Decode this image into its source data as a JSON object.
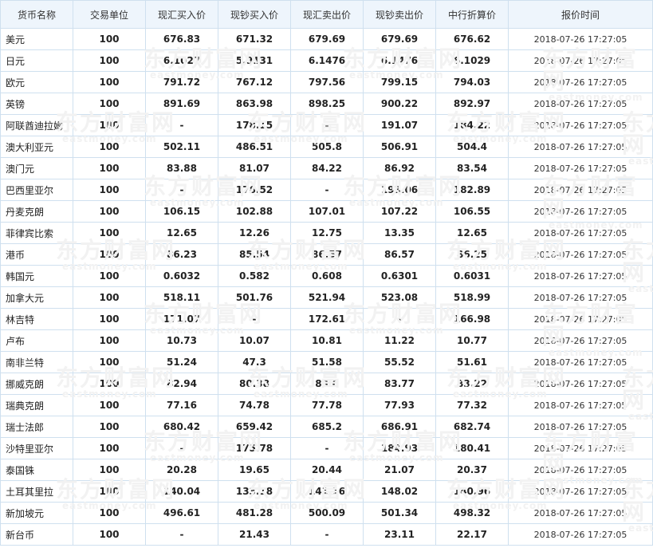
{
  "headers": [
    "货币名称",
    "交易单位",
    "现汇买入价",
    "现钞买入价",
    "现汇卖出价",
    "现钞卖出价",
    "中行折算价",
    "报价时间"
  ],
  "watermark": {
    "cn": "东方财富网",
    "en": "eastmoney.com"
  },
  "rows": [
    {
      "name": "美元",
      "unit": "100",
      "fx_buy": "676.83",
      "cash_buy": "671.32",
      "fx_sell": "679.69",
      "cash_sell": "679.69",
      "mid": "676.62",
      "time": "2018-07-26 17:27:05"
    },
    {
      "name": "日元",
      "unit": "100",
      "fx_buy": "6.1027",
      "cash_buy": "5.9131",
      "fx_sell": "6.1476",
      "cash_sell": "6.1476",
      "mid": "6.1029",
      "time": "2018-07-26 17:27:05"
    },
    {
      "name": "欧元",
      "unit": "100",
      "fx_buy": "791.72",
      "cash_buy": "767.12",
      "fx_sell": "797.56",
      "cash_sell": "799.15",
      "mid": "794.03",
      "time": "2018-07-26 17:27:05"
    },
    {
      "name": "英镑",
      "unit": "100",
      "fx_buy": "891.69",
      "cash_buy": "863.98",
      "fx_sell": "898.25",
      "cash_sell": "900.22",
      "mid": "892.97",
      "time": "2018-07-26 17:27:05"
    },
    {
      "name": "阿联酋迪拉姆",
      "unit": "100",
      "fx_buy": "-",
      "cash_buy": "178.15",
      "fx_sell": "-",
      "cash_sell": "191.07",
      "mid": "184.22",
      "time": "2018-07-26 17:27:05"
    },
    {
      "name": "澳大利亚元",
      "unit": "100",
      "fx_buy": "502.11",
      "cash_buy": "486.51",
      "fx_sell": "505.8",
      "cash_sell": "506.91",
      "mid": "504.4",
      "time": "2018-07-26 17:27:05"
    },
    {
      "name": "澳门元",
      "unit": "100",
      "fx_buy": "83.88",
      "cash_buy": "81.07",
      "fx_sell": "84.22",
      "cash_sell": "86.92",
      "mid": "83.54",
      "time": "2018-07-26 17:27:05"
    },
    {
      "name": "巴西里亚尔",
      "unit": "100",
      "fx_buy": "-",
      "cash_buy": "176.52",
      "fx_sell": "-",
      "cash_sell": "193.06",
      "mid": "182.89",
      "time": "2018-07-26 17:27:05"
    },
    {
      "name": "丹麦克朗",
      "unit": "100",
      "fx_buy": "106.15",
      "cash_buy": "102.88",
      "fx_sell": "107.01",
      "cash_sell": "107.22",
      "mid": "106.55",
      "time": "2018-07-26 17:27:05"
    },
    {
      "name": "菲律宾比索",
      "unit": "100",
      "fx_buy": "12.65",
      "cash_buy": "12.26",
      "fx_sell": "12.75",
      "cash_sell": "13.35",
      "mid": "12.65",
      "time": "2018-07-26 17:27:05"
    },
    {
      "name": "港币",
      "unit": "100",
      "fx_buy": "86.23",
      "cash_buy": "85.54",
      "fx_sell": "86.57",
      "cash_sell": "86.57",
      "mid": "86.25",
      "time": "2018-07-26 17:27:05"
    },
    {
      "name": "韩国元",
      "unit": "100",
      "fx_buy": "0.6032",
      "cash_buy": "0.582",
      "fx_sell": "0.608",
      "cash_sell": "0.6301",
      "mid": "0.6031",
      "time": "2018-07-26 17:27:05"
    },
    {
      "name": "加拿大元",
      "unit": "100",
      "fx_buy": "518.11",
      "cash_buy": "501.76",
      "fx_sell": "521.94",
      "cash_sell": "523.08",
      "mid": "518.99",
      "time": "2018-07-26 17:27:05"
    },
    {
      "name": "林吉特",
      "unit": "100",
      "fx_buy": "171.07",
      "cash_buy": "-",
      "fx_sell": "172.61",
      "cash_sell": "-",
      "mid": "166.98",
      "time": "2018-07-26 17:27:05"
    },
    {
      "name": "卢布",
      "unit": "100",
      "fx_buy": "10.73",
      "cash_buy": "10.07",
      "fx_sell": "10.81",
      "cash_sell": "11.22",
      "mid": "10.77",
      "time": "2018-07-26 17:27:05"
    },
    {
      "name": "南非兰特",
      "unit": "100",
      "fx_buy": "51.24",
      "cash_buy": "47.3",
      "fx_sell": "51.58",
      "cash_sell": "55.52",
      "mid": "51.61",
      "time": "2018-07-26 17:27:05"
    },
    {
      "name": "挪威克朗",
      "unit": "100",
      "fx_buy": "82.94",
      "cash_buy": "80.38",
      "fx_sell": "83.6",
      "cash_sell": "83.77",
      "mid": "83.22",
      "time": "2018-07-26 17:27:05"
    },
    {
      "name": "瑞典克朗",
      "unit": "100",
      "fx_buy": "77.16",
      "cash_buy": "74.78",
      "fx_sell": "77.78",
      "cash_sell": "77.93",
      "mid": "77.32",
      "time": "2018-07-26 17:27:05"
    },
    {
      "name": "瑞士法郎",
      "unit": "100",
      "fx_buy": "680.42",
      "cash_buy": "659.42",
      "fx_sell": "685.2",
      "cash_sell": "686.91",
      "mid": "682.74",
      "time": "2018-07-26 17:27:05"
    },
    {
      "name": "沙特里亚尔",
      "unit": "100",
      "fx_buy": "-",
      "cash_buy": "175.78",
      "fx_sell": "-",
      "cash_sell": "184.93",
      "mid": "180.41",
      "time": "2018-07-26 17:27:05"
    },
    {
      "name": "泰国铢",
      "unit": "100",
      "fx_buy": "20.28",
      "cash_buy": "19.65",
      "fx_sell": "20.44",
      "cash_sell": "21.07",
      "mid": "20.37",
      "time": "2018-07-26 17:27:05"
    },
    {
      "name": "土耳其里拉",
      "unit": "100",
      "fx_buy": "140.04",
      "cash_buy": "133.18",
      "fx_sell": "141.16",
      "cash_sell": "148.02",
      "mid": "140.96",
      "time": "2018-07-26 17:27:05"
    },
    {
      "name": "新加坡元",
      "unit": "100",
      "fx_buy": "496.61",
      "cash_buy": "481.28",
      "fx_sell": "500.09",
      "cash_sell": "501.34",
      "mid": "498.32",
      "time": "2018-07-26 17:27:05"
    },
    {
      "name": "新台币",
      "unit": "100",
      "fx_buy": "-",
      "cash_buy": "21.43",
      "fx_sell": "-",
      "cash_sell": "23.11",
      "mid": "22.17",
      "time": "2018-07-26 17:27:05"
    }
  ]
}
